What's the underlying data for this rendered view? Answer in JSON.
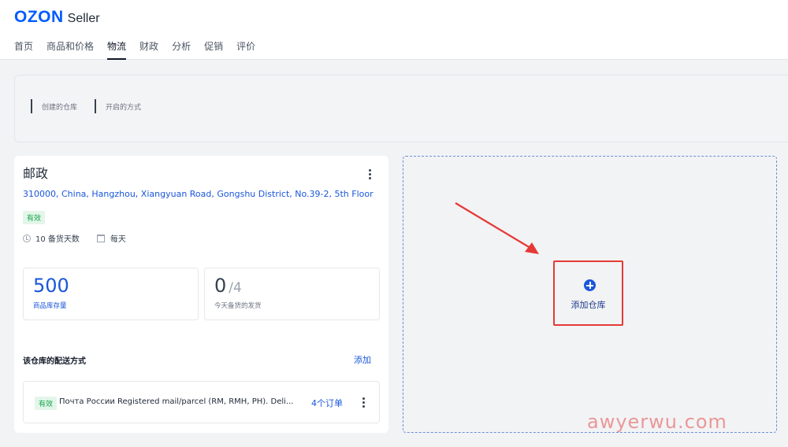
{
  "brand": {
    "name": "OZON",
    "product": "Seller",
    "color": "#005bff"
  },
  "nav": {
    "items": [
      {
        "label": "首页"
      },
      {
        "label": "商品和价格"
      },
      {
        "label": "物流",
        "active": true
      },
      {
        "label": "财政"
      },
      {
        "label": "分析"
      },
      {
        "label": "促销"
      },
      {
        "label": "评价"
      }
    ]
  },
  "summary": {
    "created_warehouses_label": "创建的仓库",
    "enabled_methods_label": "开启的方式"
  },
  "warehouse": {
    "name": "邮政",
    "address": "310000, China, Hangzhou, Xiangyuan Road, Gongshu District, No.39-2, 5th Floor",
    "status": "有效",
    "prep_days": "10 备货天数",
    "schedule": "每天",
    "stock": {
      "value": "500",
      "label": "商品库存量"
    },
    "today_shipments": {
      "value": "0",
      "limit": "/4",
      "label": "今天备货的发货"
    },
    "delivery_methods_title": "该仓库的配送方式",
    "add_label": "添加",
    "methods": [
      {
        "status": "有效",
        "name": "Почта России Registered mail/parcel (RM, RMH, PH). Deli...",
        "orders": "4个订单"
      }
    ]
  },
  "add_warehouse": {
    "label": "添加仓库"
  },
  "watermark": "awyerwu.com",
  "colors": {
    "link": "#1a56db",
    "status_green": "#16a34a",
    "highlight_red": "#e53935"
  }
}
